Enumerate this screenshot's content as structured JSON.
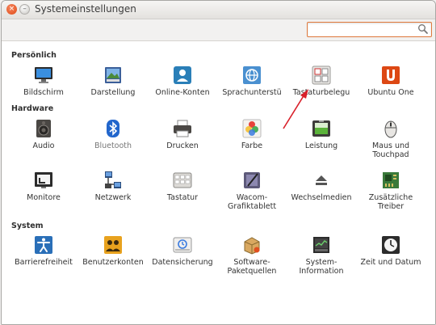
{
  "window": {
    "title": "Systemeinstellungen"
  },
  "search": {
    "placeholder": "",
    "value": ""
  },
  "sections": [
    {
      "title": "Persönlich",
      "items": [
        {
          "label": "Bildschirm",
          "icon": "monitor-icon"
        },
        {
          "label": "Darstellung",
          "icon": "appearance-icon"
        },
        {
          "label": "Online-Konten",
          "icon": "online-accounts-icon"
        },
        {
          "label": "Sprachunterstü",
          "icon": "language-icon"
        },
        {
          "label": "Tastaturbelegu",
          "icon": "keyboard-layout-icon"
        },
        {
          "label": "Ubuntu One",
          "icon": "ubuntu-one-icon"
        }
      ]
    },
    {
      "title": "Hardware",
      "items": [
        {
          "label": "Audio",
          "icon": "speaker-icon"
        },
        {
          "label": "Bluetooth",
          "icon": "bluetooth-icon"
        },
        {
          "label": "Drucken",
          "icon": "printer-icon"
        },
        {
          "label": "Farbe",
          "icon": "color-icon"
        },
        {
          "label": "Leistung",
          "icon": "battery-icon"
        },
        {
          "label": "Maus und\nTouchpad",
          "icon": "mouse-icon"
        },
        {
          "label": "Monitore",
          "icon": "displays-icon"
        },
        {
          "label": "Netzwerk",
          "icon": "network-icon"
        },
        {
          "label": "Tastatur",
          "icon": "keyboard-icon"
        },
        {
          "label": "Wacom-\nGrafiktablett",
          "icon": "tablet-icon"
        },
        {
          "label": "Wechselmedien",
          "icon": "removable-media-icon"
        },
        {
          "label": "Zusätzliche\nTreiber",
          "icon": "drivers-icon"
        }
      ]
    },
    {
      "title": "System",
      "items": [
        {
          "label": "Barrierefreiheit",
          "icon": "accessibility-icon"
        },
        {
          "label": "Benutzerkonten",
          "icon": "user-accounts-icon"
        },
        {
          "label": "Datensicherung",
          "icon": "backup-icon"
        },
        {
          "label": "Software-\nPaketquellen",
          "icon": "software-sources-icon"
        },
        {
          "label": "System-\nInformation",
          "icon": "system-info-icon"
        },
        {
          "label": "Zeit und Datum",
          "icon": "clock-icon"
        }
      ]
    }
  ],
  "annotation": {
    "color": "#d9202a",
    "icon": "red-arrow-pointing-to-keyboard-layout"
  },
  "colors": {
    "accent": "#e07a3d",
    "close_button": "#df4a16",
    "ubuntu_orange": "#dd4814"
  }
}
